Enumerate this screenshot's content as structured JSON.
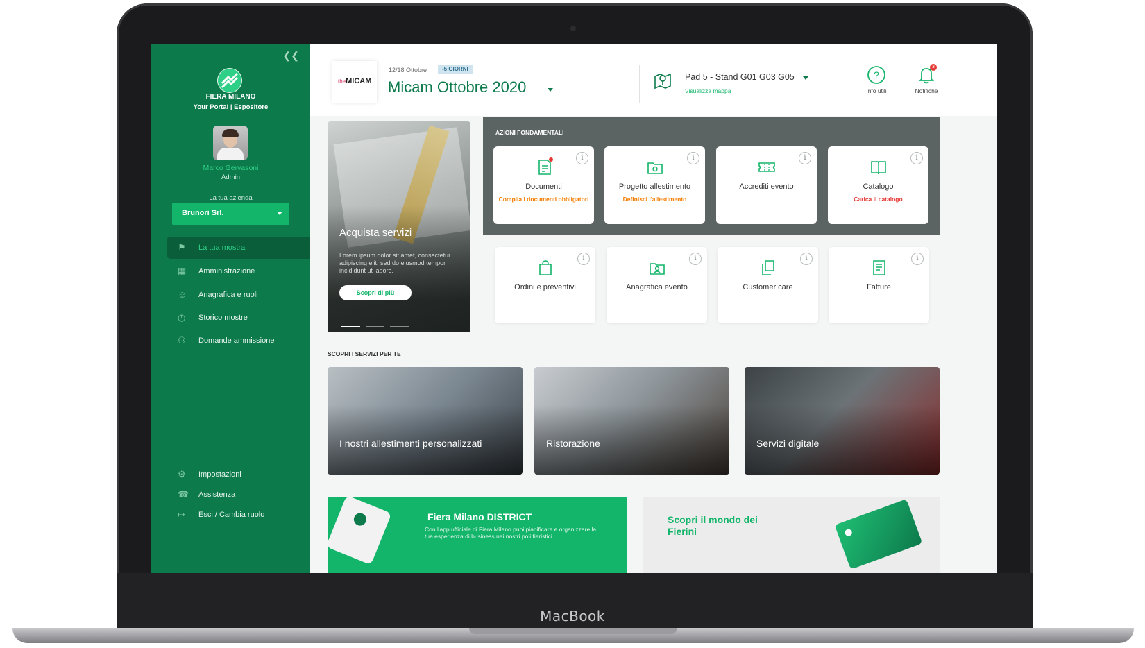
{
  "device": {
    "brand_label": "MacBook"
  },
  "sidebar": {
    "collapse_icon": "double-chevron-left",
    "brand_name": "FIERA MILANO",
    "brand_sub": "Your Portal | Espositore",
    "user": {
      "name": "Marco Gervasoni",
      "role": "Admin"
    },
    "company_label": "La tua azienda",
    "company_value": "Brunori Srl.",
    "nav": [
      {
        "label": "La tua mostra",
        "icon": "flag",
        "active": true
      },
      {
        "label": "Amministrazione",
        "icon": "calendar"
      },
      {
        "label": "Anagrafica e ruoli",
        "icon": "person"
      },
      {
        "label": "Storico mostre",
        "icon": "clock"
      },
      {
        "label": "Domande ammissione",
        "icon": "people"
      }
    ],
    "footer": [
      {
        "label": "Impostazioni",
        "icon": "gear"
      },
      {
        "label": "Assistenza",
        "icon": "headset"
      },
      {
        "label": "Esci / Cambia ruolo",
        "icon": "logout"
      }
    ]
  },
  "header": {
    "event_logo": "MICAM",
    "event_logo_prefix": "the",
    "event_date": "12/18 Ottobre",
    "event_badge": "-5 GIORNI",
    "event_title": "Micam Ottobre 2020",
    "stand_label": "Pad 5 - Stand G01 G03 G05",
    "stand_link": "Visualizza mappa",
    "info_label": "Info utili",
    "notif_label": "Notifiche",
    "notif_count": "3"
  },
  "promo": {
    "title": "Acquista servizi",
    "text": "Lorem ipsum dolor sit amet, consectetur adipiscing elit, sed do eiusmod tempor incididunt ut labore.",
    "button": "Scopri di più"
  },
  "actions": {
    "panel_title": "AZIONI FONDAMENTALI",
    "primary": [
      {
        "label": "Documenti",
        "sub": "Compila i documenti obbligatori",
        "sub_color": "#f57c00",
        "icon": "document"
      },
      {
        "label": "Progetto allestimento",
        "sub": "Definisci l'allestimento",
        "sub_color": "#f57c00",
        "icon": "folder-gear"
      },
      {
        "label": "Accrediti evento",
        "sub": "",
        "icon": "ticket"
      },
      {
        "label": "Catalogo",
        "sub": "Carica il catalogo",
        "sub_color": "#e53935",
        "icon": "book"
      }
    ],
    "secondary": [
      {
        "label": "Ordini e preventivi",
        "icon": "shopping-bag"
      },
      {
        "label": "Anagrafica evento",
        "icon": "id-folder"
      },
      {
        "label": "Customer care",
        "icon": "copies"
      },
      {
        "label": "Fatture",
        "icon": "invoice"
      }
    ]
  },
  "services": {
    "title": "SCOPRI I SERVIZI PER TE",
    "items": [
      "I nostri allestimenti personalizzati",
      "Ristorazione",
      "Servizi digitale"
    ]
  },
  "banners": {
    "district_title": "Fiera Milano DISTRICT",
    "district_text": "Con l'app ufficiale di Fiera Milano puoi pianificare e organizzare la tua esperienza di business nei nostri poli fieristici",
    "fierini_title": "Scopri il mondo dei Fierini"
  },
  "colors": {
    "brand_green": "#0d7a4c",
    "accent_green": "#13b56a",
    "warning": "#f57c00",
    "alert": "#e53935"
  }
}
